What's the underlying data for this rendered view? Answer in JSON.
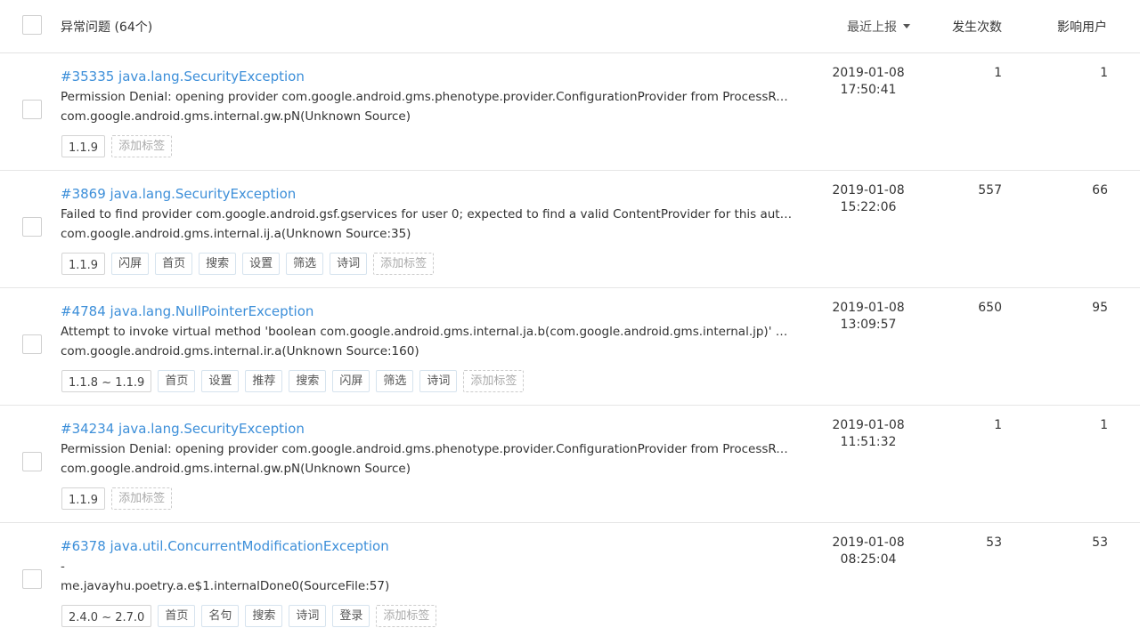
{
  "header": {
    "title": "异常问题 (64个)",
    "sort_label": "最近上报",
    "count_label": "发生次数",
    "users_label": "影响用户"
  },
  "issues": [
    {
      "title": "#35335 java.lang.SecurityException",
      "message": "Permission Denial: opening provider com.google.android.gms.phenotype.provider.ConfigurationProvider from ProcessRecord{da…",
      "stack": "com.google.android.gms.internal.gw.pN(Unknown Source)",
      "version": "1.1.9",
      "tags": [],
      "add_tag": "添加标签",
      "date": "2019-01-08",
      "time": "17:50:41",
      "count": "1",
      "users": "1"
    },
    {
      "title": "#3869 java.lang.SecurityException",
      "message": "Failed to find provider com.google.android.gsf.gservices for user 0; expected to find a valid ContentProvider for this authority",
      "stack": "com.google.android.gms.internal.ij.a(Unknown Source:35)",
      "version": "1.1.9",
      "tags": [
        "闪屏",
        "首页",
        "搜索",
        "设置",
        "筛选",
        "诗词"
      ],
      "add_tag": "添加标签",
      "date": "2019-01-08",
      "time": "15:22:06",
      "count": "557",
      "users": "66"
    },
    {
      "title": "#4784 java.lang.NullPointerException",
      "message": "Attempt to invoke virtual method 'boolean com.google.android.gms.internal.ja.b(com.google.android.gms.internal.jp)' on a null o…",
      "stack": "com.google.android.gms.internal.ir.a(Unknown Source:160)",
      "version": "1.1.8 ~ 1.1.9",
      "tags": [
        "首页",
        "设置",
        "推荐",
        "搜索",
        "闪屏",
        "筛选",
        "诗词"
      ],
      "add_tag": "添加标签",
      "date": "2019-01-08",
      "time": "13:09:57",
      "count": "650",
      "users": "95"
    },
    {
      "title": "#34234 java.lang.SecurityException",
      "message": "Permission Denial: opening provider com.google.android.gms.phenotype.provider.ConfigurationProvider from ProcessRecord{fc…",
      "stack": "com.google.android.gms.internal.gw.pN(Unknown Source)",
      "version": "1.1.9",
      "tags": [],
      "add_tag": "添加标签",
      "date": "2019-01-08",
      "time": "11:51:32",
      "count": "1",
      "users": "1"
    },
    {
      "title": "#6378 java.util.ConcurrentModificationException",
      "message": "-",
      "stack": "me.javayhu.poetry.a.e$1.internalDone0(SourceFile:57)",
      "version": "2.4.0 ~ 2.7.0",
      "tags": [
        "首页",
        "名句",
        "搜索",
        "诗词",
        "登录"
      ],
      "add_tag": "添加标签",
      "date": "2019-01-08",
      "time": "08:25:04",
      "count": "53",
      "users": "53"
    }
  ]
}
